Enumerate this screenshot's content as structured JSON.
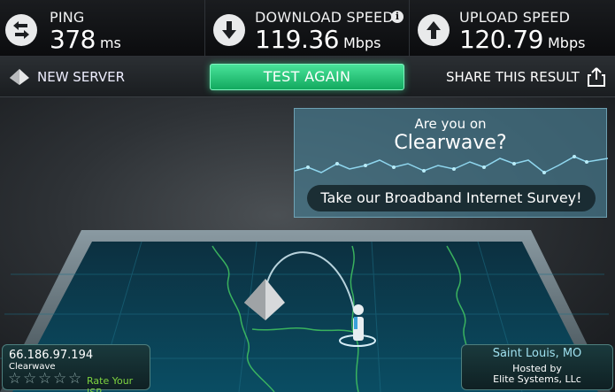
{
  "metrics": {
    "ping": {
      "label": "PING",
      "value": "378",
      "unit": "ms",
      "icon": "ping-arrows-icon"
    },
    "download": {
      "label": "DOWNLOAD SPEED",
      "value": "119.36",
      "unit": "Mbps",
      "icon": "download-arrow-icon"
    },
    "upload": {
      "label": "UPLOAD SPEED",
      "value": "120.79",
      "unit": "Mbps",
      "icon": "upload-arrow-icon"
    }
  },
  "actions": {
    "new_server": "NEW SERVER",
    "test_again": "TEST AGAIN",
    "share": "SHARE THIS RESULT"
  },
  "survey": {
    "question": "Are you on",
    "isp": "Clearwave?",
    "cta": "Take our Broadband Internet Survey!"
  },
  "client": {
    "ip": "66.186.97.194",
    "isp": "Clearwave",
    "rate_label": "Rate Your ISP",
    "rating_stars": 0
  },
  "server": {
    "city": "Saint Louis, MO",
    "hosted_label": "Hosted by",
    "host": "Elite Systems, LLc"
  },
  "colors": {
    "accent_green": "#12a95e",
    "panel_teal": "#46788c",
    "rate_green": "#7ed33f",
    "city_blue": "#9fe0ef"
  }
}
